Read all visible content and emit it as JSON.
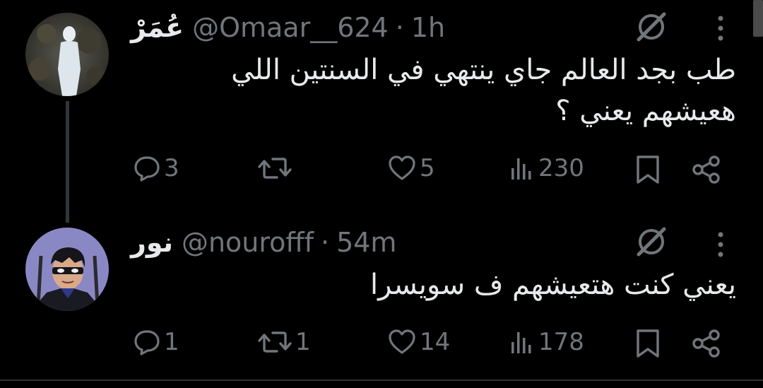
{
  "tweets": [
    {
      "name": "عُمَرْ",
      "handle": "@Omaar__624",
      "separator": "·",
      "time": "1h",
      "text": "طب بجد العالم جاي ينتهي في السنتين اللي هعيشهم يعني ؟",
      "actions": {
        "replies": "3",
        "retweets": "",
        "likes": "5",
        "views": "230"
      },
      "icons": {
        "avatar": "silhouette-avatar-icon",
        "grok": "grok-icon",
        "more": "more-icon"
      }
    },
    {
      "name": "نور",
      "handle": "@nourofff",
      "separator": "·",
      "time": "54m",
      "text": "يعني كنت هتعيشهم ف سويسرا",
      "actions": {
        "replies": "1",
        "retweets": "1",
        "likes": "14",
        "views": "178"
      },
      "icons": {
        "avatar": "masked-character-avatar-icon",
        "grok": "grok-icon",
        "more": "more-icon"
      }
    }
  ],
  "colors": {
    "background": "#000000",
    "text": "#e7e9ea",
    "muted": "#71767b",
    "thread_line": "#333639"
  }
}
